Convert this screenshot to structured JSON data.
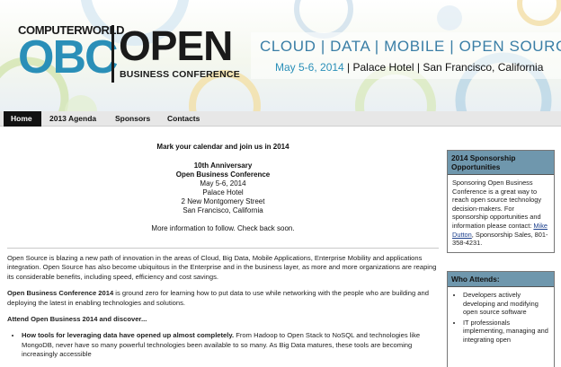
{
  "banner": {
    "publisher": "COMPUTERWORLD",
    "acronym": "OBC",
    "open": "OPEN",
    "conference": "BUSINESS CONFERENCE",
    "tagline": "CLOUD | DATA | MOBILE | OPEN SOURCE",
    "dates": "May 5-6, 2014",
    "venue": " | Palace Hotel | San Francisco, California",
    "colors": {
      "accent": "#2a8fb8",
      "dark": "#1a1a1a"
    }
  },
  "nav": {
    "items": [
      {
        "label": "Home",
        "active": true
      },
      {
        "label": "2013 Agenda",
        "active": false
      },
      {
        "label": "Sponsors",
        "active": false
      },
      {
        "label": "Contacts",
        "active": false
      }
    ]
  },
  "main": {
    "headline": "Mark your calendar and join us in 2014",
    "anniversary": "10th Anniversary",
    "conf_name": "Open Business Conference",
    "date": "May 5-6, 2014",
    "hotel": "Palace Hotel",
    "street": "2 New Montgomery Street",
    "city": "San Francisco, California",
    "more_info": "More information to follow. Check back soon.",
    "para1": "Open Source is blazing a new path of innovation in the areas of Cloud, Big Data, Mobile Applications, Enterprise Mobility and applications integration. Open Source has also become ubiquitous in the Enterprise and in the business layer, as more and more organizations are reaping its considerable benefits, including speed, efficiency and cost savings.",
    "para2_strong": "Open Business Conference 2014",
    "para2_rest": " is ground zero for learning how to put data to use while networking with the people who are building and deploying the latest in enabling technologies and solutions.",
    "attend_heading": "Attend Open Business 2014 and discover...",
    "bullet1_strong": "How tools for leveraging data have opened up almost completely.",
    "bullet1_rest": " From Hadoop to Open Stack to NoSQL and technologies like MongoDB, never have so many powerful technologies been available to so many. As Big Data matures, these tools are becoming increasingly accessible"
  },
  "sidebar": {
    "sponsorship": {
      "title": "2014 Sponsorship Opportunities",
      "body_before": "Sponsoring Open Business Conference is a great way to reach open source technology decision-makers. For sponsorship opportunities and information please contact: ",
      "contact_name": "Mike Dutton",
      "body_after": ", Sponsorship Sales, 801-358-4231."
    },
    "attendees": {
      "title": "Who Attends:",
      "items": [
        "Developers actively developing and modifying open source software",
        "IT professionals implementing, managing and integrating open"
      ]
    }
  }
}
